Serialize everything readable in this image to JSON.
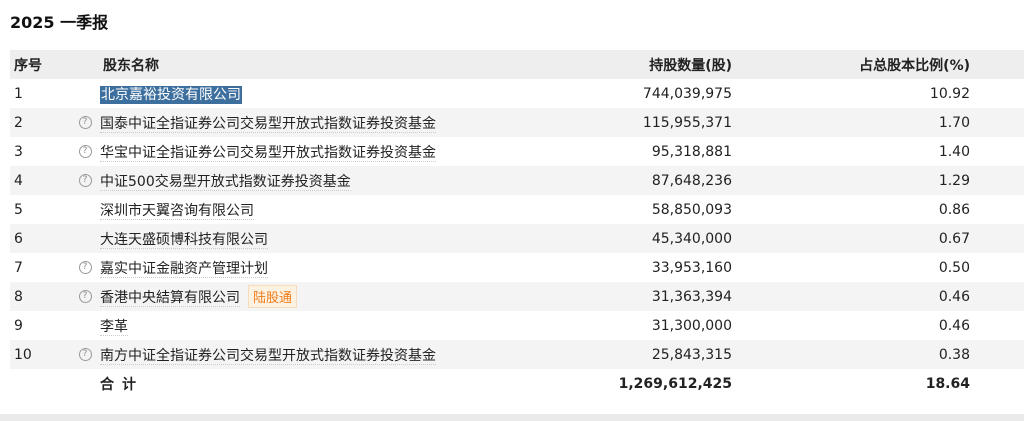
{
  "report_title": "2025 一季报",
  "table": {
    "headers": {
      "no": "序号",
      "name": "股东名称",
      "quantity": "持股数量(股)",
      "percent": "占总股本比例(%)"
    },
    "rows": [
      {
        "no": "1",
        "name": "北京嘉裕投资有限公司",
        "quantity": "744,039,975",
        "percent": "10.92",
        "help": false,
        "selected": true
      },
      {
        "no": "2",
        "name": "国泰中证全指证券公司交易型开放式指数证券投资基金",
        "quantity": "115,955,371",
        "percent": "1.70",
        "help": true
      },
      {
        "no": "3",
        "name": "华宝中证全指证券公司交易型开放式指数证券投资基金",
        "quantity": "95,318,881",
        "percent": "1.40",
        "help": true
      },
      {
        "no": "4",
        "name": "中证500交易型开放式指数证券投资基金",
        "quantity": "87,648,236",
        "percent": "1.29",
        "help": true
      },
      {
        "no": "5",
        "name": "深圳市天翼咨询有限公司",
        "quantity": "58,850,093",
        "percent": "0.86",
        "help": false
      },
      {
        "no": "6",
        "name": "大连天盛硕博科技有限公司",
        "quantity": "45,340,000",
        "percent": "0.67",
        "help": false
      },
      {
        "no": "7",
        "name": "嘉实中证金融资产管理计划",
        "quantity": "33,953,160",
        "percent": "0.50",
        "help": true
      },
      {
        "no": "8",
        "name": "香港中央結算有限公司",
        "quantity": "31,363,394",
        "percent": "0.46",
        "help": true,
        "tag": "陆股通"
      },
      {
        "no": "9",
        "name": "李革",
        "quantity": "31,300,000",
        "percent": "0.46",
        "help": false
      },
      {
        "no": "10",
        "name": "南方中证全指证券公司交易型开放式指数证券投资基金",
        "quantity": "25,843,315",
        "percent": "0.38",
        "help": true
      }
    ],
    "total": {
      "label": "合计",
      "quantity": "1,269,612,425",
      "percent": "18.64"
    }
  },
  "icons": {
    "help": "question-circle-icon"
  },
  "colors": {
    "selection": "#3c6e9e",
    "tag_text": "#ef7d1a",
    "tag_bg": "#fdf1e2"
  }
}
